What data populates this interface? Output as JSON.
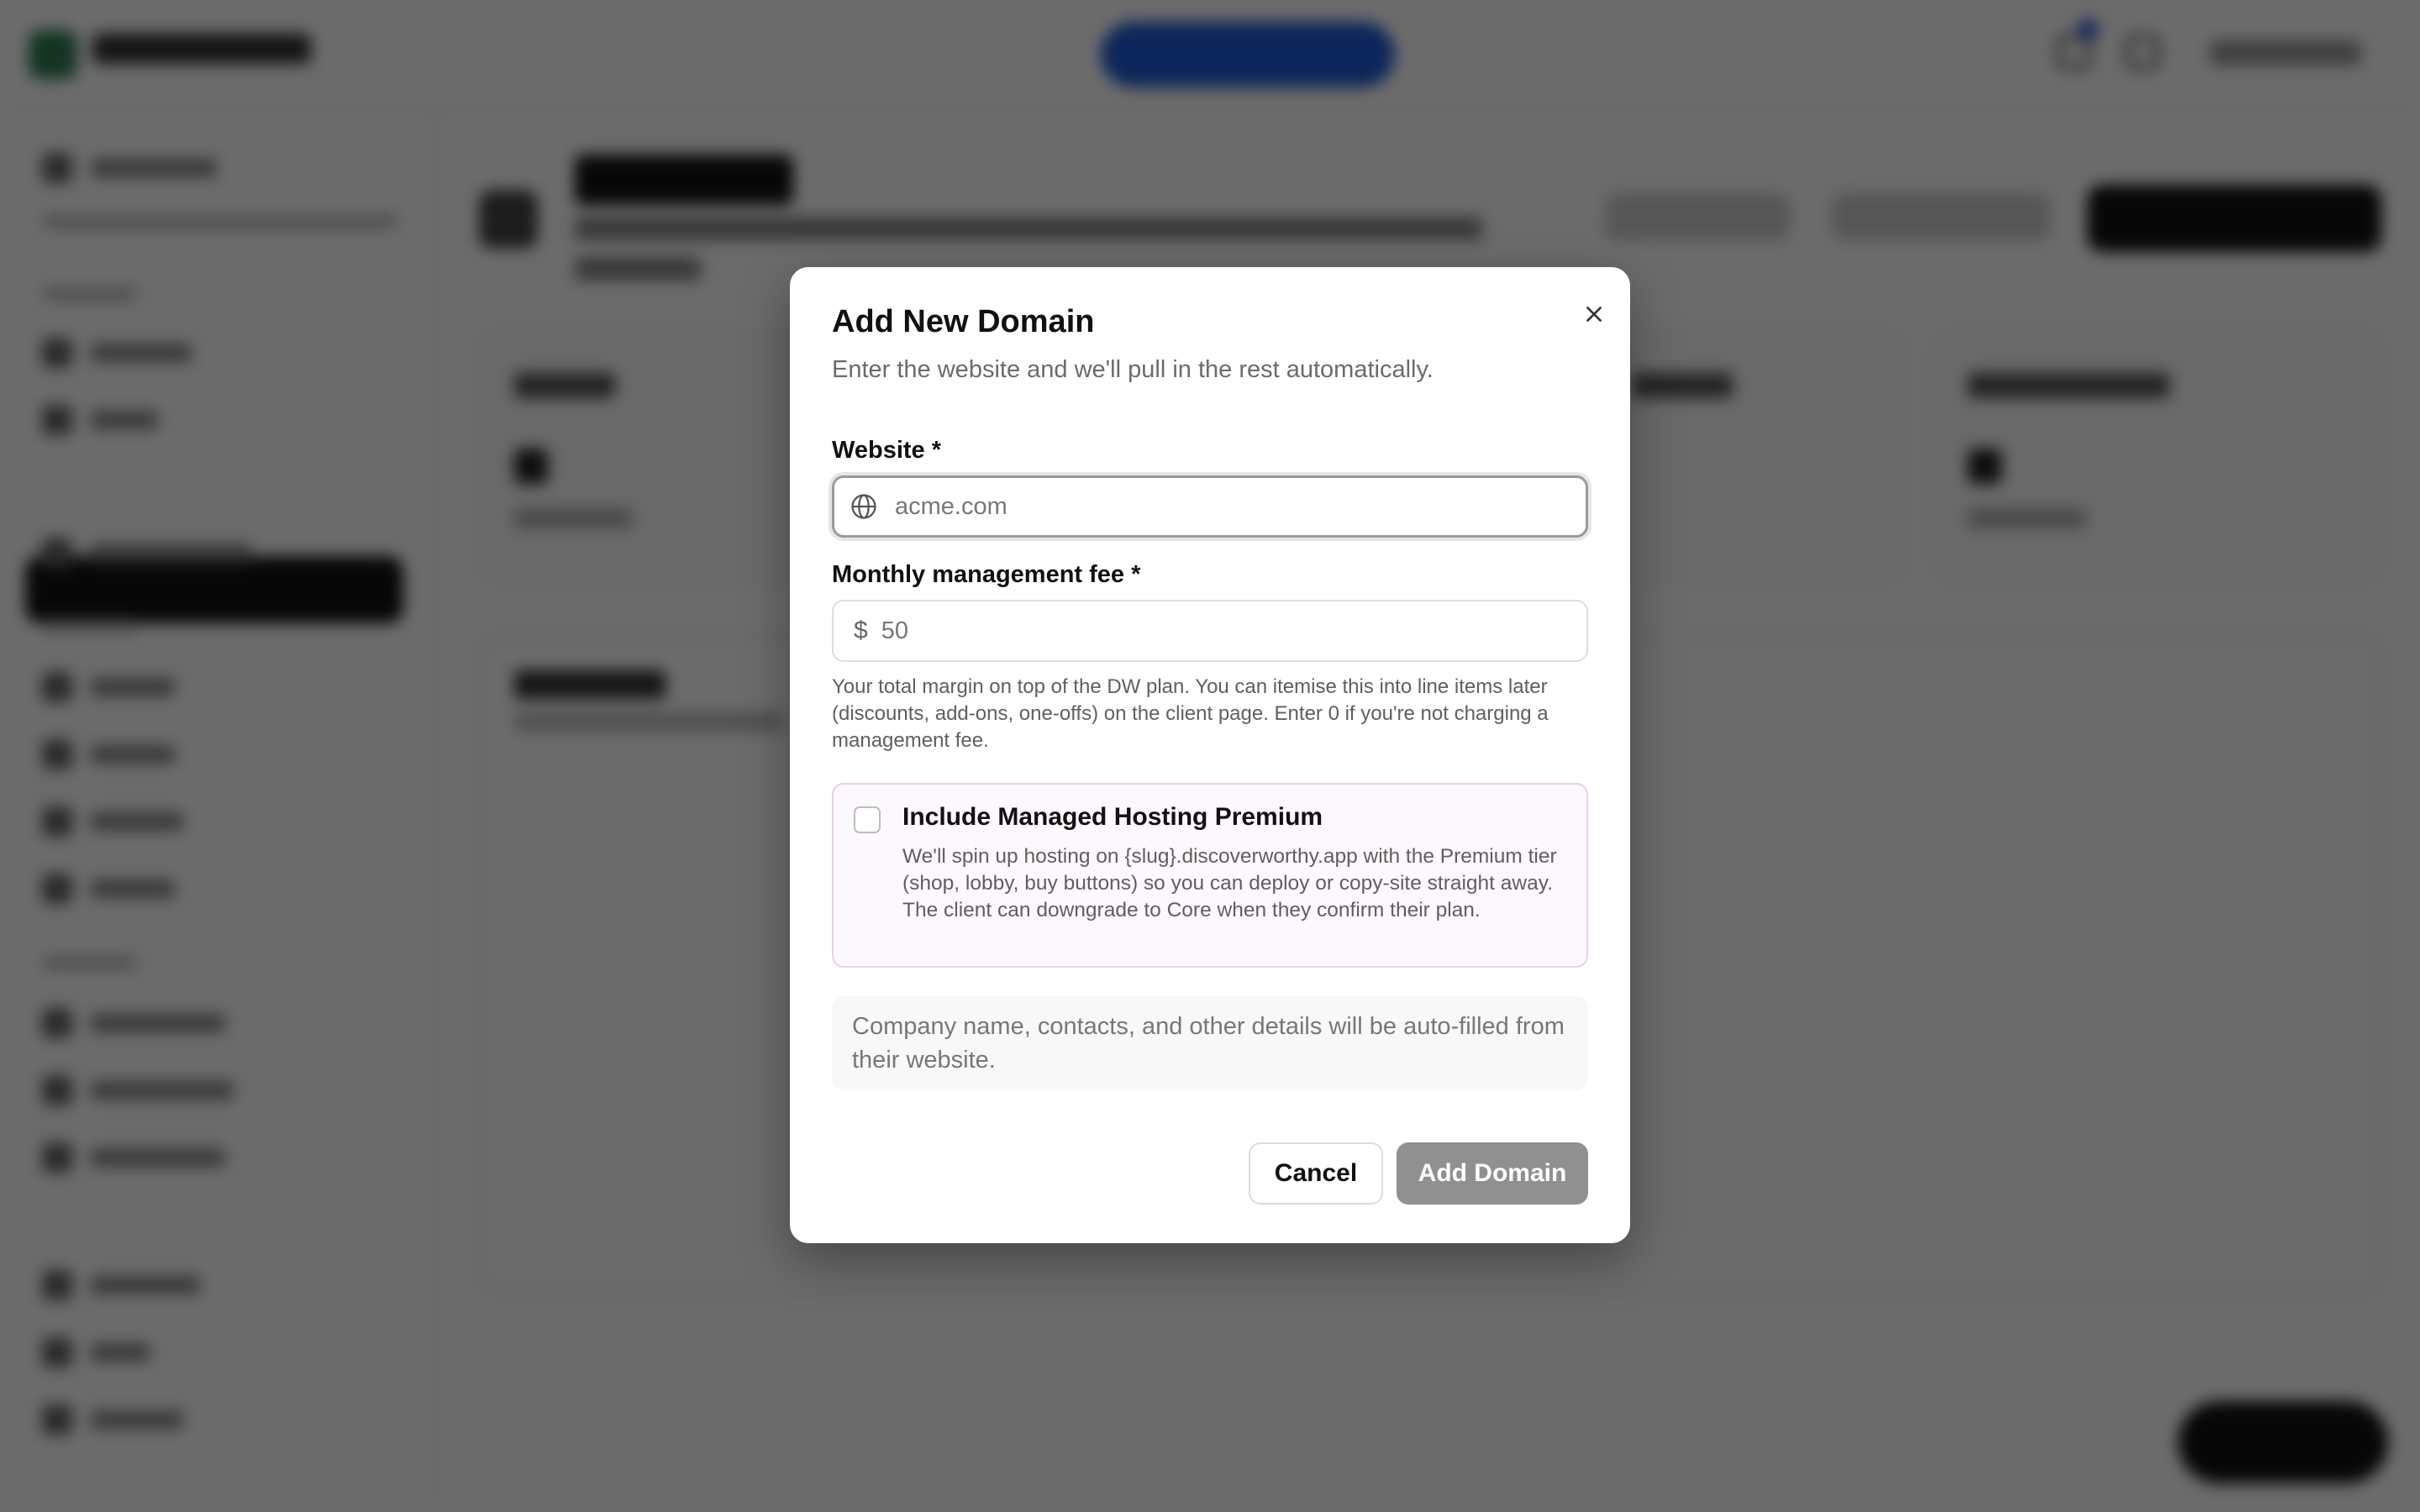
{
  "modal": {
    "title": "Add New Domain",
    "subtitle": "Enter the website and we'll pull in the rest automatically.",
    "website": {
      "label": "Website *",
      "placeholder": "acme.com",
      "value": "",
      "icon": "globe-icon"
    },
    "fee": {
      "label": "Monthly management fee *",
      "currency_symbol": "$",
      "placeholder": "50",
      "value": "",
      "help": "Your total margin on top of the DW plan. You can itemise this into line items later (discounts, add-ons, one-offs) on the client page. Enter 0 if you're not charging a management fee."
    },
    "premium": {
      "checked": false,
      "title": "Include Managed Hosting Premium",
      "description": "We'll spin up hosting on {slug}.discoverworthy.app with the Premium tier (shop, lobby, buy buttons) so you can deploy or copy-site straight away. The client can downgrade to Core when they confirm their plan."
    },
    "info": "Company name, contacts, and other details will be auto-filled from their website.",
    "buttons": {
      "cancel": "Cancel",
      "submit": "Add Domain"
    },
    "close_icon": "close-icon"
  },
  "colors": {
    "overlay": "rgba(0,0,0,0.58)",
    "submit_disabled": "#909090",
    "premium_border": "#ead0ec",
    "premium_bg": "#fdf8fd"
  }
}
